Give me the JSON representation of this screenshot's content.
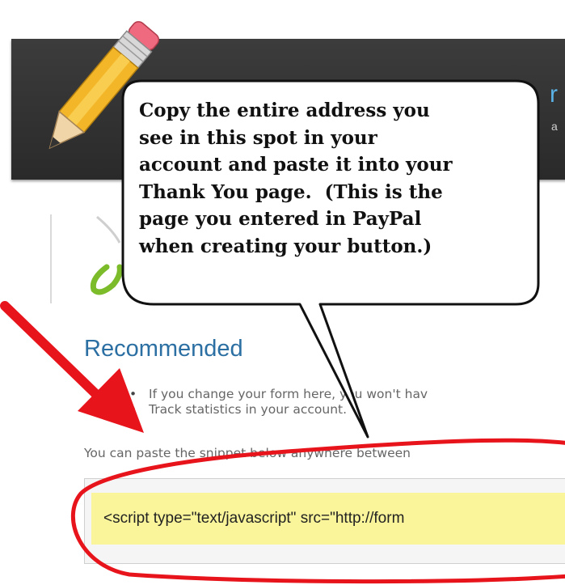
{
  "header": {
    "brand_fragment": "r",
    "sub_fragment": "a"
  },
  "callout": {
    "text": "Copy the entire address you\nsee in this spot in your\naccount and paste it into your\nThank You page.  (This is the\npage you entered in PayPal\nwhen creating your button.)"
  },
  "content": {
    "heading": "Recommended",
    "bullets": [
      "If you change your form here, you won't hav",
      "Track statistics in your account."
    ],
    "paste_instructions": "You can paste the snippet below anywhere between",
    "snippet": "<script type=\"text/javascript\" src=\"http://form"
  },
  "colors": {
    "heading": "#2b6fa3",
    "header_bar": "#2e2e2e",
    "snippet_highlight": "#faf59a",
    "annotation": "#e8141c"
  },
  "icons": [
    "pencil-icon",
    "arrow-annotation",
    "circle-annotation",
    "speech-bubble"
  ]
}
